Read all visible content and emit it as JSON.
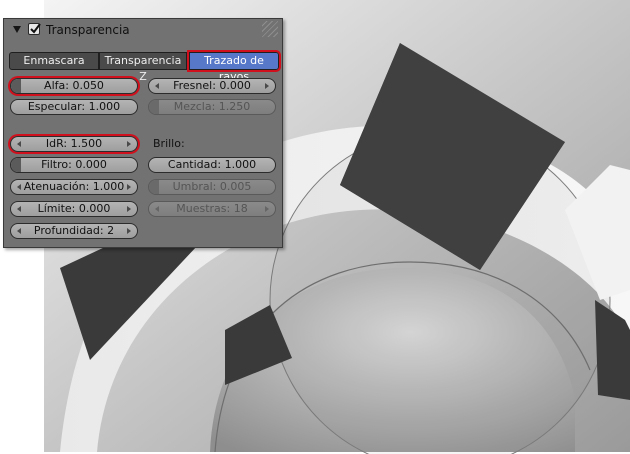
{
  "panel": {
    "title": "Transparencia",
    "enabled": true,
    "tabs": [
      {
        "label": "Enmascara",
        "active": false
      },
      {
        "label": "Transparencia Z",
        "active": false
      },
      {
        "label": "Trazado de rayos",
        "active": true
      }
    ],
    "fields": {
      "alfa": {
        "label": "Alfa: 0.050",
        "fill": 0.05
      },
      "fresnel": {
        "label": "Fresnel: 0.000"
      },
      "especular": {
        "label": "Especular: 1.000",
        "fill": 1.0
      },
      "mezcla": {
        "label": "Mezcla: 1.250"
      },
      "idr": {
        "label": "IdR: 1.500"
      },
      "brillo_label": "Brillo:",
      "filtro": {
        "label": "Filtro: 0.000",
        "fill": 0.0
      },
      "cantidad": {
        "label": "Cantidad: 1.000",
        "fill": 1.0
      },
      "atenuacion": {
        "label": "Atenuación: 1.000"
      },
      "umbral": {
        "label": "Umbral: 0.005",
        "fill": 0.005
      },
      "limite": {
        "label": "Límite: 0.000"
      },
      "muestras": {
        "label": "Muestras: 18"
      },
      "profundidad": {
        "label": "Profundidad: 2"
      }
    },
    "accent": "#5778c8",
    "highlight": "#d0101c"
  }
}
